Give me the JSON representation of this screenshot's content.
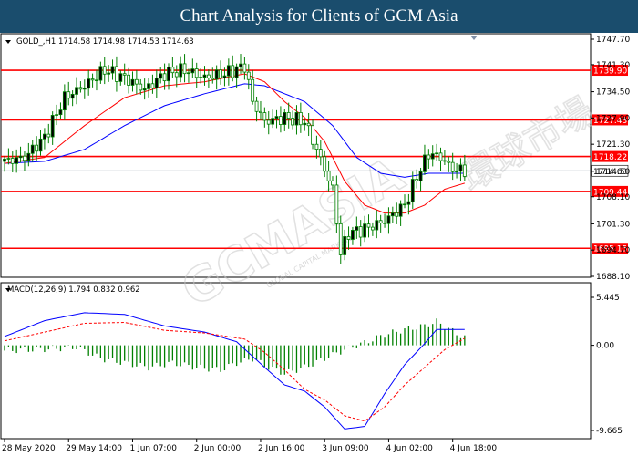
{
  "header": {
    "title": "Chart Analysis for Clients of GCM Asia"
  },
  "watermark": {
    "text": "GCMASIA",
    "subtext": "GLOBAL CAPITAL MARKETS",
    "chinese": "環球市場"
  },
  "colors": {
    "header_bg": "#1a4d6d",
    "level_line": "#ff0000",
    "candle_body": "#008000",
    "ma_fast": "#ff0000",
    "ma_slow": "#0000ff",
    "current_price_line": "#708090",
    "macd_hist": "#008000",
    "macd_signal": "#ff0000"
  },
  "chart_data": [
    {
      "type": "candlestick",
      "info_text": "GOLD_,H1  1714.58 1714.98 1714.53 1714.63",
      "symbol": "GOLD_,H1",
      "ohlc_readout": {
        "open": 1714.58,
        "high": 1714.98,
        "low": 1714.53,
        "close": 1714.63
      },
      "y_ticks": [
        "1747.70",
        "1741.30",
        "1734.50",
        "1727.90",
        "1721.30",
        "1714.50",
        "1708.10",
        "1701.30",
        "1694.70",
        "1688.10"
      ],
      "ylim": [
        1688.1,
        1747.7
      ],
      "x_labels": [
        "28 May 2020",
        "29 May 14:00",
        "1 Jun 07:00",
        "2 Jun 00:00",
        "2 Jun 16:00",
        "3 Jun 09:00",
        "4 Jun 02:00",
        "4 Jun 18:00"
      ],
      "x_label_candle_index": [
        0,
        16,
        32,
        48,
        64,
        80,
        96,
        112
      ],
      "levels": [
        {
          "label": "1739.90",
          "value": 1739.9
        },
        {
          "label": "1727.43",
          "value": 1727.43
        },
        {
          "label": "1718.22",
          "value": 1718.22
        },
        {
          "label": "1709.44",
          "value": 1709.44
        },
        {
          "label": "1695.15",
          "value": 1695.15
        }
      ],
      "current_price": {
        "label": "1714.63",
        "value": 1714.63
      },
      "close_anchors": [
        [
          0,
          1717
        ],
        [
          5,
          1718
        ],
        [
          10,
          1723
        ],
        [
          15,
          1733
        ],
        [
          20,
          1736
        ],
        [
          25,
          1740
        ],
        [
          30,
          1738
        ],
        [
          35,
          1735
        ],
        [
          40,
          1739
        ],
        [
          45,
          1740
        ],
        [
          50,
          1738
        ],
        [
          55,
          1739
        ],
        [
          60,
          1741
        ],
        [
          62,
          1732
        ],
        [
          65,
          1727
        ],
        [
          70,
          1728
        ],
        [
          75,
          1727
        ],
        [
          78,
          1720
        ],
        [
          82,
          1710
        ],
        [
          84,
          1694
        ],
        [
          86,
          1699
        ],
        [
          90,
          1700
        ],
        [
          95,
          1702
        ],
        [
          100,
          1706
        ],
        [
          103,
          1713
        ],
        [
          106,
          1719
        ],
        [
          109,
          1718
        ],
        [
          112,
          1715
        ],
        [
          115,
          1714.6
        ]
      ],
      "ma_fast_anchors": [
        [
          0,
          1716.5
        ],
        [
          10,
          1718
        ],
        [
          20,
          1726
        ],
        [
          30,
          1733
        ],
        [
          40,
          1736
        ],
        [
          50,
          1737
        ],
        [
          60,
          1739
        ],
        [
          65,
          1737
        ],
        [
          70,
          1732
        ],
        [
          75,
          1728
        ],
        [
          80,
          1722
        ],
        [
          85,
          1712
        ],
        [
          90,
          1706
        ],
        [
          95,
          1704
        ],
        [
          100,
          1704
        ],
        [
          105,
          1706
        ],
        [
          110,
          1710
        ],
        [
          115,
          1711.5
        ]
      ],
      "ma_slow_anchors": [
        [
          0,
          1716.5
        ],
        [
          10,
          1717
        ],
        [
          20,
          1720
        ],
        [
          30,
          1726
        ],
        [
          40,
          1731
        ],
        [
          50,
          1734
        ],
        [
          60,
          1736.5
        ],
        [
          65,
          1736
        ],
        [
          75,
          1732
        ],
        [
          82,
          1726
        ],
        [
          88,
          1718
        ],
        [
          94,
          1714
        ],
        [
          100,
          1713
        ],
        [
          106,
          1714
        ],
        [
          111,
          1714
        ],
        [
          115,
          1714
        ]
      ]
    },
    {
      "type": "bar",
      "name": "MACD(12,26,9)",
      "info_text": "MACD(12,26,9)  1.794  0.832  0.962",
      "readout": [
        1.794,
        0.832,
        0.962
      ],
      "y_ticks": [
        "5.445",
        "0.00",
        "-9.665"
      ],
      "ylim": [
        -9.665,
        5.445
      ],
      "hist_anchors": [
        [
          0,
          -0.6
        ],
        [
          12,
          -0.4
        ],
        [
          18,
          -0.2
        ],
        [
          24,
          -1.5
        ],
        [
          30,
          -2
        ],
        [
          36,
          -2.5
        ],
        [
          42,
          -2
        ],
        [
          48,
          -2.5
        ],
        [
          54,
          -2.8
        ],
        [
          58,
          -2
        ],
        [
          62,
          -1.5
        ],
        [
          66,
          -2.5
        ],
        [
          70,
          -3.2
        ],
        [
          75,
          -2.5
        ],
        [
          80,
          -1.5
        ],
        [
          85,
          -0.5
        ],
        [
          90,
          0.3
        ],
        [
          95,
          1.2
        ],
        [
          100,
          1.8
        ],
        [
          105,
          2.2
        ],
        [
          108,
          2.7
        ],
        [
          111,
          1.9
        ],
        [
          113,
          1.3
        ],
        [
          115,
          0.9
        ]
      ],
      "signal_anchors": [
        [
          0,
          0.5
        ],
        [
          10,
          1.5
        ],
        [
          20,
          2.5
        ],
        [
          30,
          2.6
        ],
        [
          40,
          1.7
        ],
        [
          50,
          1.4
        ],
        [
          60,
          0.7
        ],
        [
          65,
          -0.8
        ],
        [
          70,
          -2.8
        ],
        [
          75,
          -5
        ],
        [
          80,
          -6.2
        ],
        [
          85,
          -8
        ],
        [
          90,
          -8.6
        ],
        [
          95,
          -7
        ],
        [
          100,
          -4.5
        ],
        [
          105,
          -2.5
        ],
        [
          110,
          -0.5
        ],
        [
          115,
          0.8
        ]
      ],
      "macd_anchors": [
        [
          0,
          1
        ],
        [
          10,
          2.8
        ],
        [
          20,
          3.7
        ],
        [
          30,
          3.5
        ],
        [
          40,
          2.2
        ],
        [
          50,
          1.5
        ],
        [
          58,
          0.4
        ],
        [
          65,
          -2.5
        ],
        [
          70,
          -4.5
        ],
        [
          75,
          -5.2
        ],
        [
          80,
          -7
        ],
        [
          85,
          -9.5
        ],
        [
          90,
          -9.2
        ],
        [
          95,
          -5.5
        ],
        [
          100,
          -2.2
        ],
        [
          105,
          0.2
        ],
        [
          108,
          1.8
        ],
        [
          112,
          1.8
        ],
        [
          115,
          1.8
        ]
      ]
    }
  ]
}
